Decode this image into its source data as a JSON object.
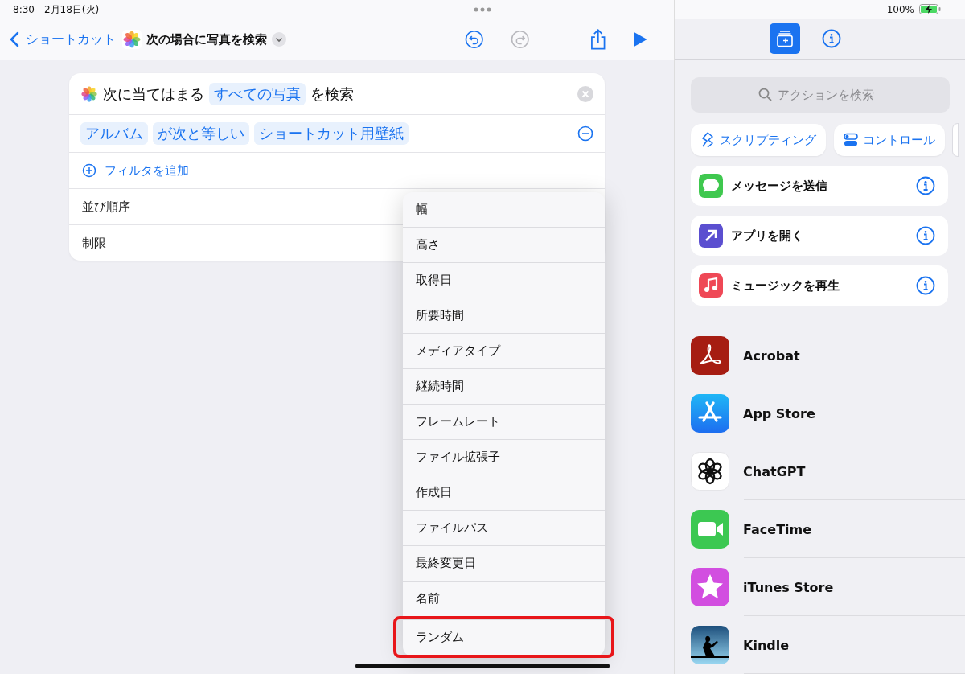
{
  "status_bar": {
    "time": "8:30",
    "date": "2月18日(火)",
    "battery": "100%"
  },
  "nav": {
    "back": "ショートカット",
    "title": "次の場合に写真を検索"
  },
  "toolbar": [
    {
      "kind": "undo",
      "disabled": false
    },
    {
      "kind": "redo",
      "disabled": true
    },
    {
      "kind": "share",
      "disabled": false
    },
    {
      "kind": "run",
      "disabled": false
    }
  ],
  "action": {
    "prefix": "次に当てはまる",
    "token": "すべての写真",
    "suffix": "を検索",
    "filter": [
      "アルバム",
      "が次と等しい",
      "ショートカット用壁紙"
    ],
    "add_filter": "フィルタを追加",
    "rows": [
      "並び順序",
      "制限"
    ]
  },
  "menu": [
    {
      "label": "幅",
      "marked": false
    },
    {
      "label": "高さ",
      "marked": false
    },
    {
      "label": "取得日",
      "marked": false
    },
    {
      "label": "所要時間",
      "marked": false
    },
    {
      "label": "メディアタイプ",
      "marked": false
    },
    {
      "label": "継続時間",
      "marked": false
    },
    {
      "label": "フレームレート",
      "marked": false
    },
    {
      "label": "ファイル拡張子",
      "marked": false
    },
    {
      "label": "作成日",
      "marked": false
    },
    {
      "label": "ファイルパス",
      "marked": false
    },
    {
      "label": "最終変更日",
      "marked": false
    },
    {
      "label": "名前",
      "marked": false
    },
    {
      "label": "ランダム",
      "marked": true
    }
  ],
  "sidebar_tabs": [
    {
      "kind": "library",
      "selected": true
    },
    {
      "kind": "info",
      "selected": false
    }
  ],
  "search": {
    "placeholder": "アクションを検索"
  },
  "categories": [
    {
      "kind": "scripting",
      "label": "スクリプティング"
    },
    {
      "kind": "controls",
      "label": "コントロール"
    }
  ],
  "suggestions": [
    {
      "kind": "messages",
      "label": "メッセージを送信"
    },
    {
      "kind": "open-app",
      "label": "アプリを開く"
    },
    {
      "kind": "music",
      "label": "ミュージックを再生"
    }
  ],
  "apps": [
    {
      "kind": "acrobat",
      "label": "Acrobat"
    },
    {
      "kind": "appstore",
      "label": "App Store"
    },
    {
      "kind": "chatgpt",
      "label": "ChatGPT"
    },
    {
      "kind": "facetime",
      "label": "FaceTime"
    },
    {
      "kind": "itunes",
      "label": "iTunes Store"
    },
    {
      "kind": "kindle",
      "label": "Kindle"
    }
  ]
}
